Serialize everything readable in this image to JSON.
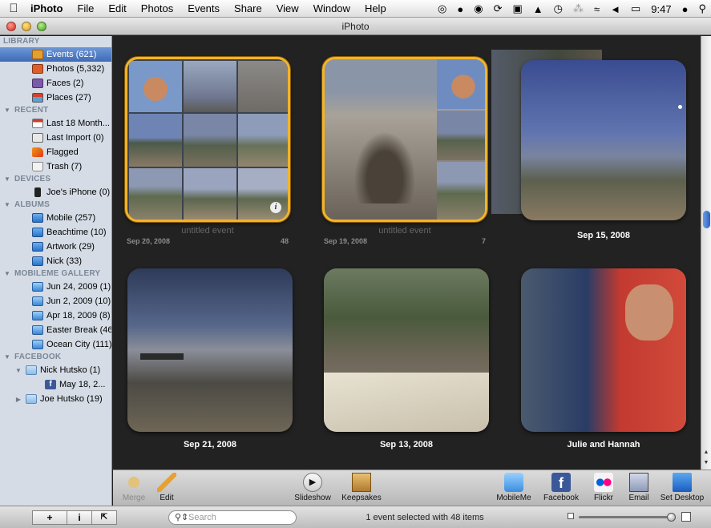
{
  "menubar": {
    "apple_icon": "apple-logo",
    "app": "iPhoto",
    "menus": [
      "File",
      "Edit",
      "Photos",
      "Events",
      "Share",
      "View",
      "Window",
      "Help"
    ],
    "clock": "9:47"
  },
  "window": {
    "title": "iPhoto"
  },
  "sidebar": {
    "library": {
      "header": "LIBRARY",
      "items": [
        {
          "label": "Events (621)",
          "icon": "events-icon",
          "selected": true
        },
        {
          "label": "Photos (5,332)",
          "icon": "photos-icon"
        },
        {
          "label": "Faces (2)",
          "icon": "faces-icon"
        },
        {
          "label": "Places (27)",
          "icon": "places-icon"
        }
      ]
    },
    "recent": {
      "header": "RECENT",
      "items": [
        {
          "label": "Last 18 Month...",
          "icon": "calendar-icon"
        },
        {
          "label": "Last Import (0)",
          "icon": "import-icon"
        },
        {
          "label": "Flagged",
          "icon": "flag-icon"
        },
        {
          "label": "Trash (7)",
          "icon": "trash-icon"
        }
      ]
    },
    "devices": {
      "header": "DEVICES",
      "items": [
        {
          "label": "Joe's iPhone (0)",
          "icon": "iphone-icon"
        }
      ]
    },
    "albums": {
      "header": "ALBUMS",
      "items": [
        {
          "label": "Mobile (257)",
          "icon": "album-icon"
        },
        {
          "label": "Beachtime (10)",
          "icon": "album-icon"
        },
        {
          "label": "Artwork (29)",
          "icon": "album-icon"
        },
        {
          "label": "Nick (33)",
          "icon": "album-icon"
        }
      ]
    },
    "mobileme": {
      "header": "MOBILEME GALLERY",
      "items": [
        {
          "label": "Jun 24, 2009 (1)",
          "icon": "gallery-icon"
        },
        {
          "label": "Jun 2, 2009 (10)",
          "icon": "gallery-icon"
        },
        {
          "label": "Apr 18, 2009 (8)",
          "icon": "gallery-icon"
        },
        {
          "label": "Easter Break (46)",
          "icon": "gallery-icon"
        },
        {
          "label": "Ocean City (111)",
          "icon": "gallery-icon"
        }
      ]
    },
    "facebook": {
      "header": "FACEBOOK",
      "items": [
        {
          "label": "Nick Hutsko (1)",
          "icon": "folder-icon",
          "level": 1,
          "expanded": true
        },
        {
          "label": "May 18, 2...",
          "icon": "facebook-album-icon",
          "level": 2
        },
        {
          "label": "Joe Hutsko (19)",
          "icon": "folder-icon",
          "level": 1,
          "expanded": false
        }
      ]
    }
  },
  "events": [
    {
      "title": "untitled event",
      "date": "Sep 20, 2008",
      "count": "48",
      "selected": true,
      "untitled": true
    },
    {
      "title": "untitled event",
      "date": "Sep 19, 2008",
      "count": "7",
      "selected": true,
      "untitled": true
    },
    {
      "title": "Sep 15, 2008",
      "selected": false
    },
    {
      "title": "Sep 21, 2008",
      "selected": false
    },
    {
      "title": "Sep 13, 2008",
      "selected": false
    },
    {
      "title": "Julie and Hannah",
      "selected": false
    }
  ],
  "toolbar": {
    "merge": "Merge",
    "edit": "Edit",
    "slideshow": "Slideshow",
    "keepsakes": "Keepsakes",
    "mobileme": "MobileMe",
    "facebook": "Facebook",
    "flickr": "Flickr",
    "email": "Email",
    "set_desktop": "Set Desktop"
  },
  "bottombar": {
    "add": "+",
    "info": "i",
    "search_placeholder": "Search",
    "status": "1 event selected with 48 items"
  },
  "colors": {
    "selection_border": "#f1b42a",
    "sidebar_bg": "#d5dce6",
    "grid_bg": "#222222"
  }
}
